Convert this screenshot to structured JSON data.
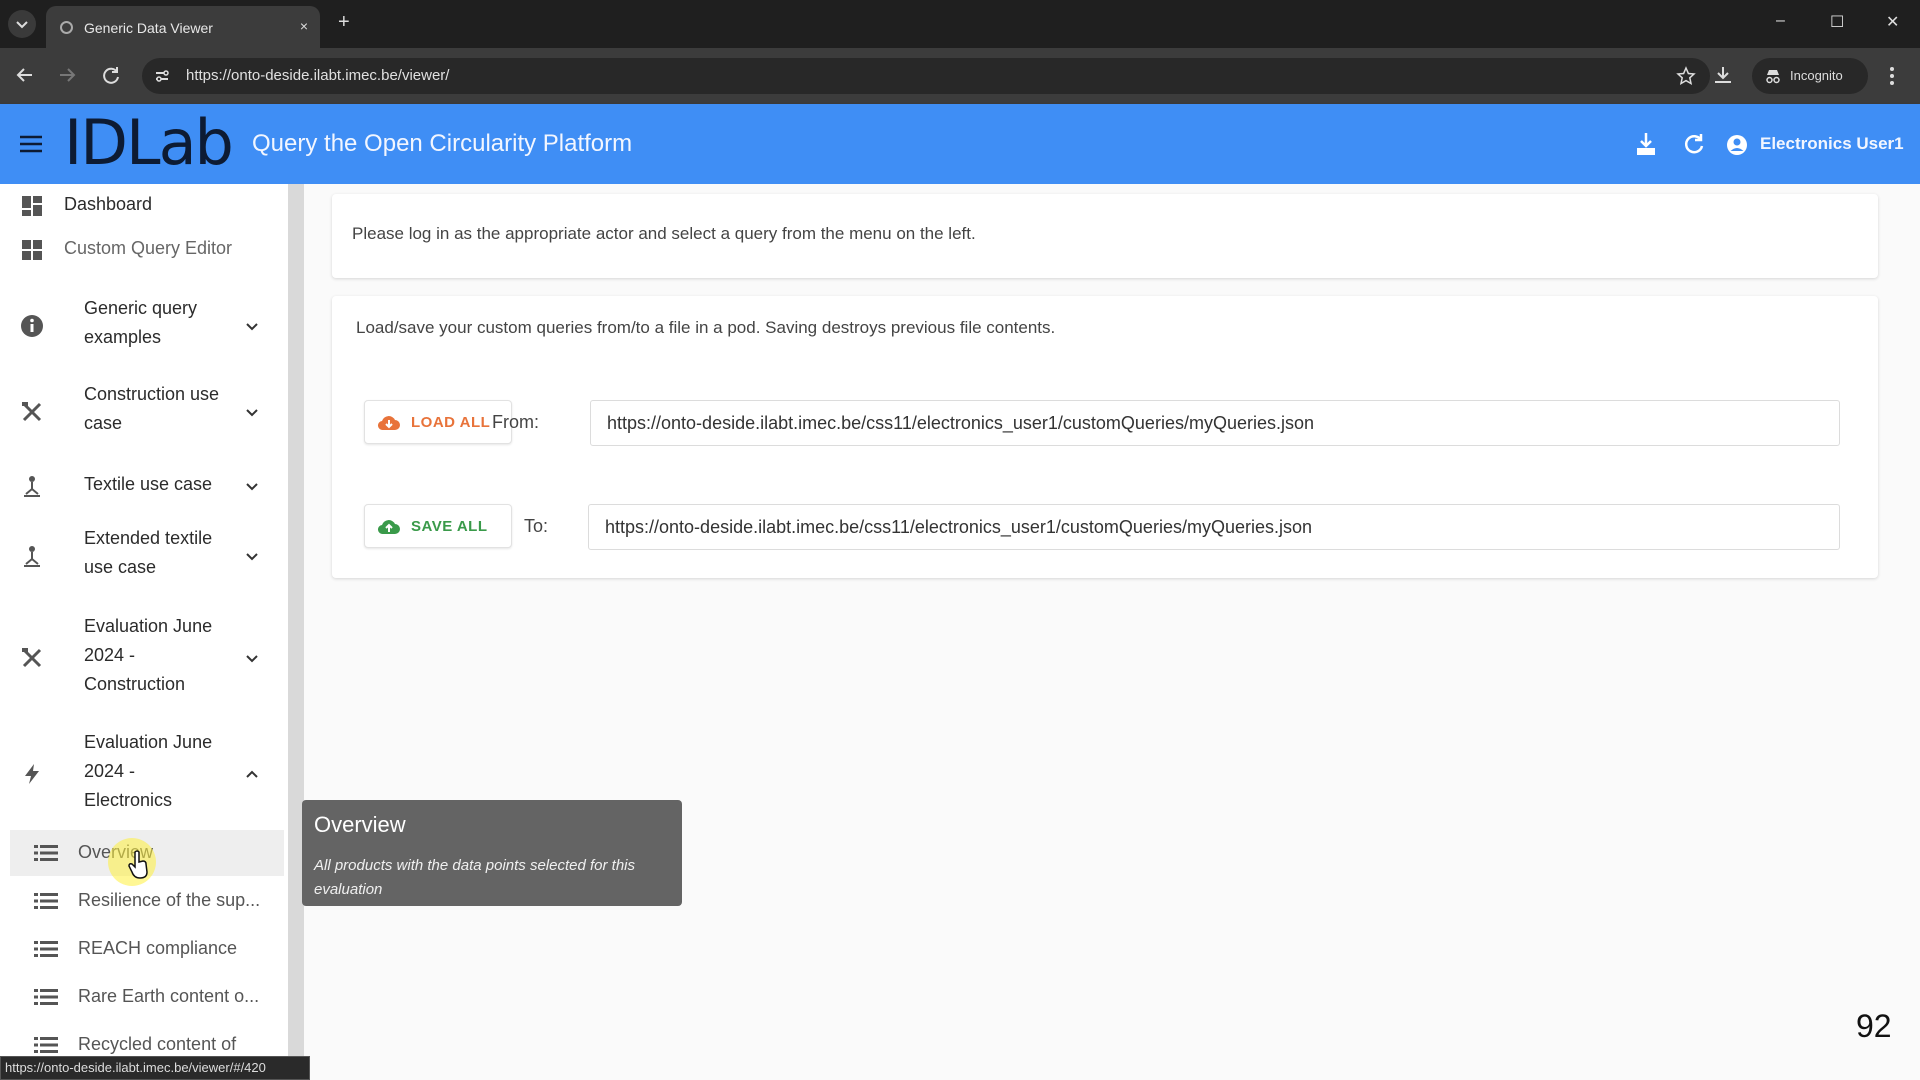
{
  "browser": {
    "tab_title": "Generic Data Viewer",
    "tab_close": "×",
    "new_tab": "+",
    "url": "https://onto-deside.ilabt.imec.be/viewer/",
    "incognito_label": "Incognito",
    "window_controls": [
      "–",
      "☐",
      "✕"
    ],
    "status_url": "https://onto-deside.ilabt.imec.be/viewer/#/420"
  },
  "appbar": {
    "logo": "IDLab",
    "title": "Query the Open Circularity Platform",
    "user_name": "Electronics User1",
    "icons": [
      "hamburger-menu-icon",
      "download-icon",
      "refresh-icon",
      "account-icon"
    ]
  },
  "sidebar": {
    "items": [
      {
        "label": "Dashboard",
        "icon": "dashboard-icon"
      },
      {
        "label": "Custom Query Editor",
        "icon": "dashboard-icon"
      },
      {
        "label": "Generic query examples",
        "icon": "info-icon",
        "expanded": false
      },
      {
        "label": "Construction use case",
        "icon": "tools-icon",
        "expanded": false
      },
      {
        "label": "Textile use case",
        "icon": "person-icon",
        "expanded": false
      },
      {
        "label": "Extended textile use case",
        "icon": "person-icon",
        "expanded": false
      },
      {
        "label": "Evaluation June 2024 - Construction",
        "icon": "tools-icon",
        "expanded": false
      },
      {
        "label": "Evaluation June 2024 - Electronics",
        "icon": "bolt-icon",
        "expanded": true
      }
    ],
    "subitems": [
      {
        "label": "Overview",
        "active": true
      },
      {
        "label": "Resilience of the sup..."
      },
      {
        "label": "REACH compliance"
      },
      {
        "label": "Rare Earth content o..."
      },
      {
        "label": "Recycled content of"
      }
    ]
  },
  "main": {
    "login_message": "Please log in as the appropriate actor and select a query from the menu on the left.",
    "loadsave_message": "Load/save your custom queries from/to a file in a pod. Saving destroys previous file contents.",
    "load_button": "LOAD ALL",
    "from_label": "From:",
    "from_url": "https://onto-deside.ilabt.imec.be/css11/electronics_user1/customQueries/myQueries.json",
    "save_button": "SAVE ALL",
    "to_label": "To:",
    "to_url": "https://onto-deside.ilabt.imec.be/css11/electronics_user1/customQueries/myQueries.json"
  },
  "tooltip": {
    "title": "Overview",
    "description": "All products with the data points selected for this evaluation"
  },
  "colors": {
    "appbar": "#3f8ef5",
    "load_accent": "#e8733a",
    "save_accent": "#3a9a4a"
  },
  "page_number": "92"
}
